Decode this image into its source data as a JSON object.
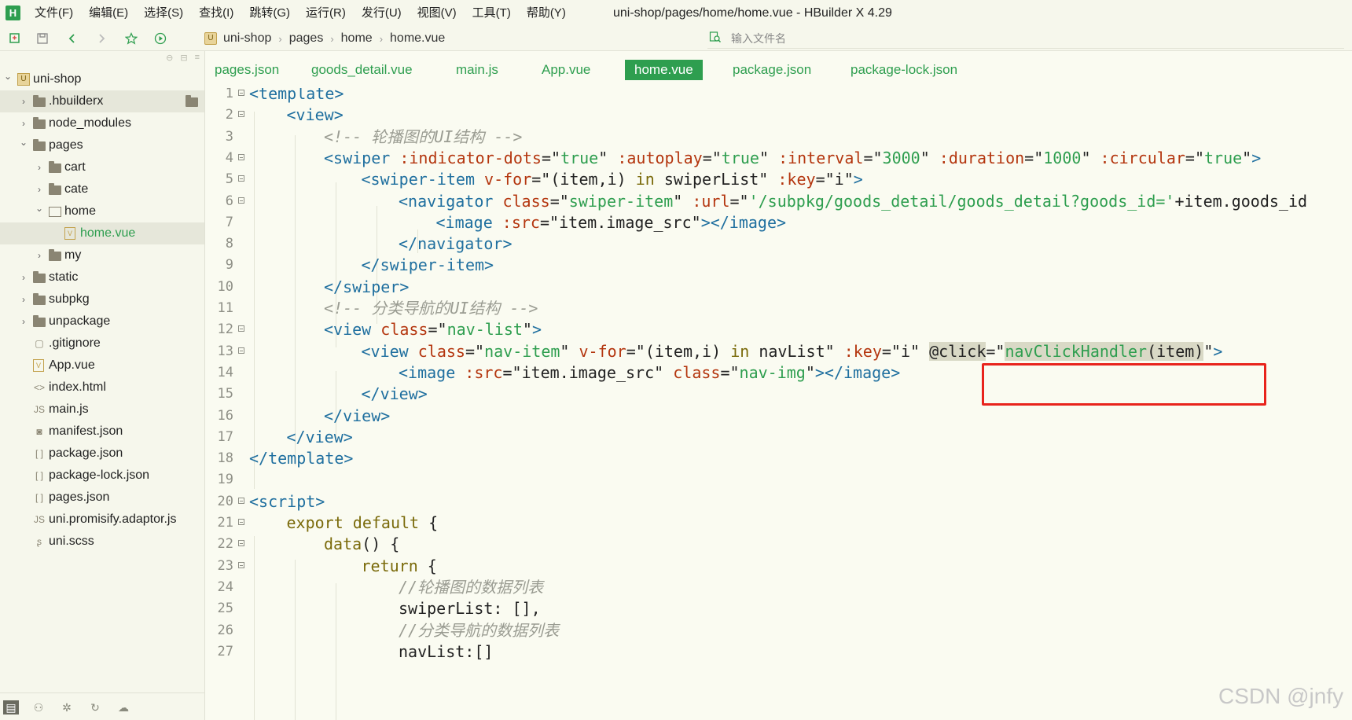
{
  "app": {
    "logo_letter": "H",
    "window_title": "uni-shop/pages/home/home.vue - HBuilder X 4.29"
  },
  "menu": [
    "文件(F)",
    "编辑(E)",
    "选择(S)",
    "查找(I)",
    "跳转(G)",
    "运行(R)",
    "发行(U)",
    "视图(V)",
    "工具(T)",
    "帮助(Y)"
  ],
  "breadcrumb": {
    "project_badge": "U",
    "items": [
      "uni-shop",
      "pages",
      "home",
      "home.vue"
    ]
  },
  "file_search": {
    "placeholder": "输入文件名"
  },
  "tree": [
    {
      "label": "uni-shop",
      "depth": 0,
      "type": "project",
      "expanded": true
    },
    {
      "label": ".hbuilderx",
      "depth": 1,
      "type": "folder",
      "expanded": false,
      "selected": true
    },
    {
      "label": "node_modules",
      "depth": 1,
      "type": "folder",
      "expanded": false
    },
    {
      "label": "pages",
      "depth": 1,
      "type": "folder",
      "expanded": true
    },
    {
      "label": "cart",
      "depth": 2,
      "type": "folder",
      "expanded": false
    },
    {
      "label": "cate",
      "depth": 2,
      "type": "folder",
      "expanded": false
    },
    {
      "label": "home",
      "depth": 2,
      "type": "folder-open",
      "expanded": true
    },
    {
      "label": "home.vue",
      "depth": 3,
      "type": "vue",
      "active": true
    },
    {
      "label": "my",
      "depth": 2,
      "type": "folder",
      "expanded": false
    },
    {
      "label": "static",
      "depth": 1,
      "type": "folder",
      "expanded": false
    },
    {
      "label": "subpkg",
      "depth": 1,
      "type": "folder",
      "expanded": false
    },
    {
      "label": "unpackage",
      "depth": 1,
      "type": "folder",
      "expanded": false
    },
    {
      "label": ".gitignore",
      "depth": 1,
      "type": "file"
    },
    {
      "label": "App.vue",
      "depth": 1,
      "type": "vue"
    },
    {
      "label": "index.html",
      "depth": 1,
      "type": "html"
    },
    {
      "label": "main.js",
      "depth": 1,
      "type": "js"
    },
    {
      "label": "manifest.json",
      "depth": 1,
      "type": "manifest"
    },
    {
      "label": "package.json",
      "depth": 1,
      "type": "json"
    },
    {
      "label": "package-lock.json",
      "depth": 1,
      "type": "json"
    },
    {
      "label": "pages.json",
      "depth": 1,
      "type": "json"
    },
    {
      "label": "uni.promisify.adaptor.js",
      "depth": 1,
      "type": "js"
    },
    {
      "label": "uni.scss",
      "depth": 1,
      "type": "scss"
    }
  ],
  "tabs": [
    {
      "label": "pages.json",
      "active": false
    },
    {
      "label": "goods_detail.vue",
      "active": false
    },
    {
      "label": "main.js",
      "active": false
    },
    {
      "label": "App.vue",
      "active": false
    },
    {
      "label": "home.vue",
      "active": true
    },
    {
      "label": "package.json",
      "active": false
    },
    {
      "label": "package-lock.json",
      "active": false
    }
  ],
  "code_lines": [
    {
      "n": "1",
      "fold": true
    },
    {
      "n": "2",
      "fold": true
    },
    {
      "n": "3",
      "fold": false
    },
    {
      "n": "4",
      "fold": true
    },
    {
      "n": "5",
      "fold": true
    },
    {
      "n": "6",
      "fold": true
    },
    {
      "n": "7",
      "fold": false
    },
    {
      "n": "8",
      "fold": false
    },
    {
      "n": "9",
      "fold": false
    },
    {
      "n": "10",
      "fold": false
    },
    {
      "n": "11",
      "fold": false
    },
    {
      "n": "12",
      "fold": true
    },
    {
      "n": "13",
      "fold": true
    },
    {
      "n": "14",
      "fold": false
    },
    {
      "n": "15",
      "fold": false
    },
    {
      "n": "16",
      "fold": false
    },
    {
      "n": "17",
      "fold": false
    },
    {
      "n": "18",
      "fold": false
    },
    {
      "n": "19",
      "fold": false
    },
    {
      "n": "20",
      "fold": true
    },
    {
      "n": "21",
      "fold": true
    },
    {
      "n": "22",
      "fold": true
    },
    {
      "n": "23",
      "fold": true
    },
    {
      "n": "24",
      "fold": false
    },
    {
      "n": "25",
      "fold": false
    },
    {
      "n": "26",
      "fold": false
    },
    {
      "n": "27",
      "fold": false
    }
  ],
  "code": {
    "l1": [
      "<template>"
    ],
    "l2": [
      "<view>"
    ],
    "l3": [
      "<!-- 轮播图的UI结构 -->"
    ],
    "l4": [
      "<swiper",
      ":indicator-dots",
      "=\"",
      "true",
      "\"",
      ":autoplay",
      "=\"",
      "true",
      "\"",
      ":interval",
      "=\"",
      "3000",
      "\"",
      ":duration",
      "=\"",
      "1000",
      "\"",
      ":circular",
      "=\"",
      "true",
      "\"",
      ">"
    ],
    "l5": [
      "<swiper-item",
      "v-for",
      "=\"",
      "(item,i)",
      "in",
      "swiperList",
      "\"",
      ":key",
      "=\"",
      "i",
      "\"",
      ">"
    ],
    "l6": [
      "<navigator",
      "class",
      "=\"",
      "swiper-item",
      "\"",
      ":url",
      "=\"",
      "'/subpkg/goods_detail/goods_detail?goods_id='",
      "+item.goods_id"
    ],
    "l7": [
      "<image",
      ":src",
      "=\"",
      "item.image_src",
      "\"",
      "></image>"
    ],
    "l8": [
      "</navigator>"
    ],
    "l9": [
      "</swiper-item>"
    ],
    "l10": [
      "</swiper>"
    ],
    "l11": [
      "<!-- 分类导航的UI结构 -->"
    ],
    "l12": [
      "<view",
      "class",
      "=\"",
      "nav-list",
      "\"",
      ">"
    ],
    "l13": [
      "<view",
      "class",
      "=\"",
      "nav-item",
      "\"",
      "v-for",
      "=\"",
      "(item,i)",
      "in",
      "navList",
      "\"",
      ":key",
      "=\"",
      "i",
      "\"",
      "@click",
      "=\"",
      "navClickHandler",
      "(item)",
      "\"",
      ">"
    ],
    "l14": [
      "<image",
      ":src",
      "=\"",
      "item.image_src",
      "\"",
      "class",
      "=\"",
      "nav-img",
      "\"",
      "></image>"
    ],
    "l15": [
      "</view>"
    ],
    "l16": [
      "</view>"
    ],
    "l17": [
      "</view>"
    ],
    "l18": [
      "</template>"
    ],
    "l20": [
      "<script>"
    ],
    "l21": [
      "export default",
      "{"
    ],
    "l22": [
      "data",
      "() {"
    ],
    "l23": [
      "return",
      "{"
    ],
    "l24": [
      "//轮播图的数据列表"
    ],
    "l25": [
      "swiperList: [],"
    ],
    "l26": [
      "//分类导航的数据列表"
    ],
    "l27": [
      "navList:[]"
    ]
  },
  "colors": {
    "accent": "#2e9e4f",
    "tag": "#1f6f9f",
    "attribute": "#b4360f",
    "highlight_box": "#e8231c",
    "background": "#fafbf1"
  },
  "icons": [
    "logo-icon",
    "new-file-icon",
    "save-icon",
    "back-icon",
    "forward-icon",
    "star-icon",
    "run-icon",
    "search-file-icon"
  ],
  "watermark": "CSDN @jnfy"
}
